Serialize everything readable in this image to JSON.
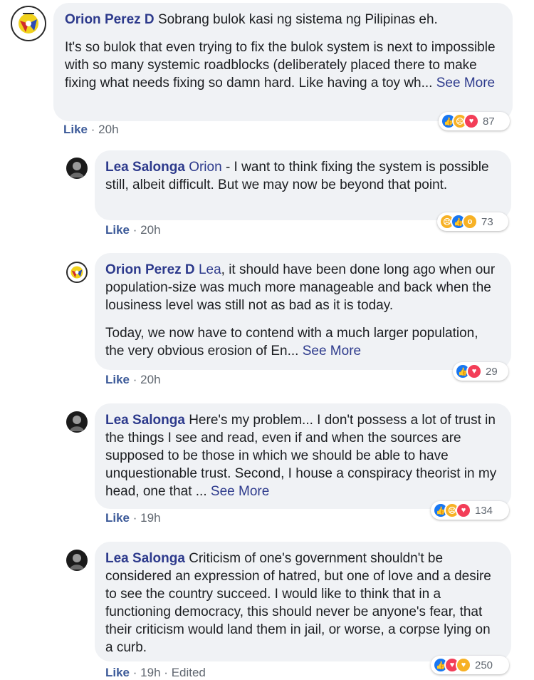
{
  "comments": [
    {
      "author": "Orion Perez D",
      "paragraphs": [
        {
          "mention": "",
          "text": "Sobrang bulok kasi ng sistema ng Pilipinas eh.",
          "see_more": ""
        },
        {
          "mention": "",
          "text": "It's so bulok that even trying to fix the bulok system is next to impossible with so many systemic roadblocks (deliberately placed there to make fixing what needs fixing so damn hard. Like having a toy wh...",
          "see_more": "See More"
        }
      ],
      "reaction_icons": [
        "like-icon",
        "sad-icon",
        "love-icon"
      ],
      "reaction_count": "87",
      "like_label": "Like",
      "time": "20h"
    },
    {
      "author": "Lea Salonga",
      "paragraphs": [
        {
          "mention": "Orion",
          "text": "- I want to think fixing the system is possible still, albeit difficult. But we may now be beyond that point.",
          "see_more": ""
        }
      ],
      "reaction_icons": [
        "sad-icon",
        "like-icon",
        "wow-icon"
      ],
      "reaction_count": "73",
      "like_label": "Like",
      "time": "20h"
    },
    {
      "author": "Orion Perez D",
      "paragraphs": [
        {
          "mention": "Lea",
          "text": ", it should have been done long ago when our population-size was much more manageable and back when the lousiness level was still not as bad as it is today.",
          "see_more": ""
        },
        {
          "mention": "",
          "text": "Today, we now have to contend with a much larger population, the very obvious erosion of En...",
          "see_more": "See More"
        }
      ],
      "reaction_icons": [
        "like-icon",
        "love-icon"
      ],
      "reaction_count": "29",
      "like_label": "Like",
      "time": "20h"
    },
    {
      "author": "Lea Salonga",
      "paragraphs": [
        {
          "mention": "",
          "text": "Here's my problem... I don't possess a lot of trust in the things I see and read, even if and when the sources are supposed to be those in which we should be able to have unquestionable trust. Second, I house a conspiracy theorist in my head, one that ...",
          "see_more": "See More"
        }
      ],
      "reaction_icons": [
        "like-icon",
        "sad-icon",
        "love-icon"
      ],
      "reaction_count": "134",
      "like_label": "Like",
      "time": "19h"
    },
    {
      "author": "Lea Salonga",
      "paragraphs": [
        {
          "mention": "",
          "text": "Criticism of one's government shouldn't be considered an expression of hatred, but one of love and a desire to see the country succeed. I would like to think that in a functioning democracy, this should never be anyone's fear, that their criticism would land them in jail, or worse, a corpse lying on a curb.",
          "see_more": ""
        }
      ],
      "reaction_icons": [
        "like-icon",
        "love-icon",
        "care-icon"
      ],
      "reaction_count": "250",
      "like_label": "Like",
      "time": "19h",
      "edited": "Edited"
    }
  ],
  "colors": {
    "bubble": "#f0f2f5",
    "author": "#2d3a8c",
    "like": "#1877f2",
    "love": "#f33e58",
    "sad": "#f7b125"
  }
}
